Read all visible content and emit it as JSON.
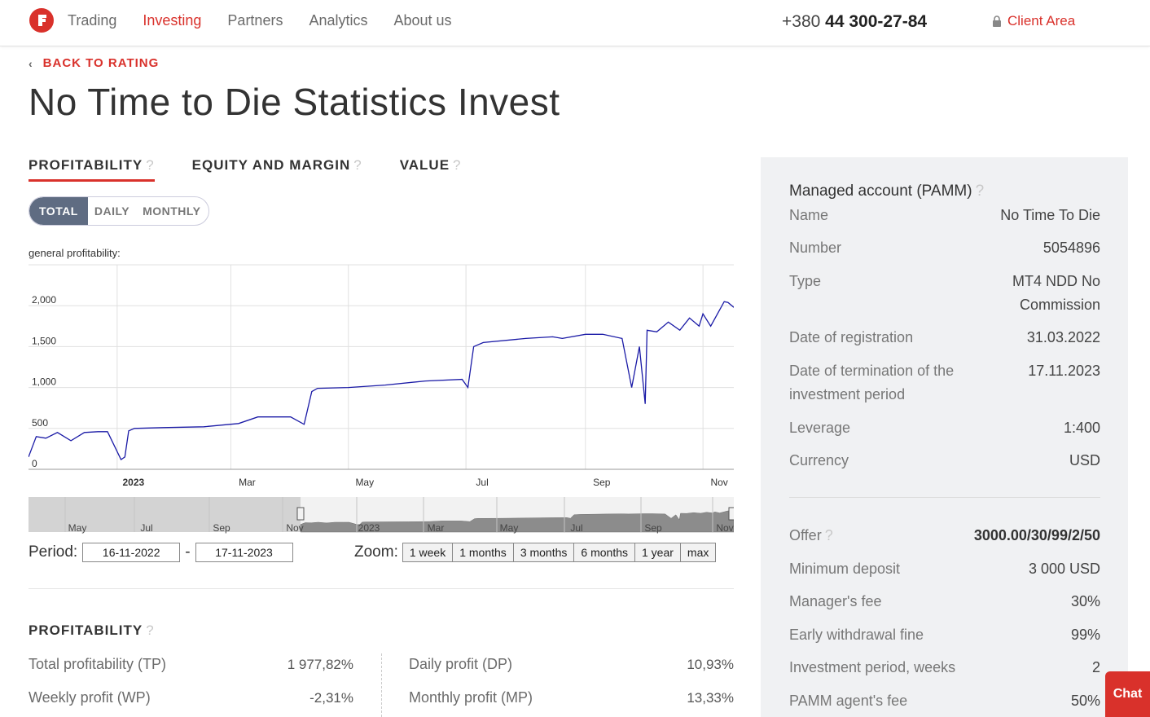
{
  "header": {
    "nav": [
      "Trading",
      "Investing",
      "Partners",
      "Analytics",
      "About us"
    ],
    "active_nav": "Investing",
    "phone_prefix": "+380 ",
    "phone_main": "44 300-27-84",
    "client_area": "Client Area"
  },
  "back_label": "BACK TO RATING",
  "page_title": "No Time to Die Statistics Invest",
  "tabs": [
    "PROFITABILITY",
    "EQUITY AND MARGIN",
    "VALUE"
  ],
  "tab_help": "?",
  "segments": [
    "TOTAL",
    "DAILY",
    "MONTHLY"
  ],
  "chart_caption": "general profitability:",
  "chart_data": {
    "type": "line",
    "title": "general profitability:",
    "x_ticks": [
      "2023",
      "Mar",
      "May",
      "Jul",
      "Sep",
      "Nov"
    ],
    "y_ticks": [
      "0",
      "500",
      "1,000",
      "1,500",
      "2,000"
    ],
    "ylim": [
      0,
      2500
    ],
    "xlim": [
      "2022-11-16",
      "2023-11-17"
    ],
    "x": [
      "2022-11-16",
      "2022-11-20",
      "2022-11-25",
      "2022-12-01",
      "2022-12-08",
      "2022-12-15",
      "2022-12-22",
      "2022-12-27",
      "2023-01-03",
      "2023-01-05",
      "2023-01-07",
      "2023-01-10",
      "2023-01-25",
      "2023-02-15",
      "2023-03-05",
      "2023-03-15",
      "2023-04-01",
      "2023-04-08",
      "2023-04-12",
      "2023-04-15",
      "2023-05-01",
      "2023-05-20",
      "2023-06-10",
      "2023-06-29",
      "2023-07-02",
      "2023-07-05",
      "2023-07-10",
      "2023-08-01",
      "2023-08-15",
      "2023-08-20",
      "2023-09-01",
      "2023-09-10",
      "2023-09-20",
      "2023-09-25",
      "2023-09-29",
      "2023-10-02",
      "2023-10-03",
      "2023-10-08",
      "2023-10-14",
      "2023-10-20",
      "2023-10-25",
      "2023-10-30",
      "2023-11-01",
      "2023-11-05",
      "2023-11-12",
      "2023-11-14",
      "2023-11-17"
    ],
    "values": [
      150,
      400,
      380,
      450,
      350,
      450,
      460,
      460,
      120,
      150,
      470,
      500,
      510,
      520,
      560,
      640,
      640,
      550,
      950,
      990,
      1000,
      1030,
      1080,
      1100,
      1000,
      1500,
      1550,
      1600,
      1620,
      1600,
      1650,
      1650,
      1600,
      1000,
      1500,
      800,
      1700,
      1680,
      1800,
      1700,
      1850,
      1750,
      1900,
      1750,
      2050,
      2040,
      1980
    ],
    "grid": true,
    "line_color": "#1a1aa6",
    "navigator_ticks": [
      "May",
      "Jul",
      "Sep",
      "Nov",
      "2023",
      "Mar",
      "May",
      "Jul",
      "Sep",
      "Nov"
    ]
  },
  "period": {
    "label": "Period:",
    "from": "16-11-2022",
    "sep": "-",
    "to": "17-11-2023"
  },
  "zoom": {
    "label": "Zoom:",
    "buttons": [
      "1 week",
      "1 months",
      "3 months",
      "6 months",
      "1 year",
      "max"
    ]
  },
  "profitability": {
    "title": "PROFITABILITY",
    "left": [
      {
        "label": "Total profitability (TP)",
        "value": "1 977,82%"
      },
      {
        "label": "Weekly profit (WP)",
        "value": "-2,31%"
      }
    ],
    "right": [
      {
        "label": "Daily profit (DP)",
        "value": "10,93%"
      },
      {
        "label": "Monthly profit (MP)",
        "value": "13,33%"
      }
    ]
  },
  "account": {
    "title": "Managed account (PAMM)",
    "rows": [
      {
        "label": "Name",
        "value": "No Time To Die"
      },
      {
        "label": "Number",
        "value": "5054896"
      },
      {
        "label": "Type",
        "value": "MT4 NDD No Commission"
      },
      {
        "label": "Date of registration",
        "value": "31.03.2022"
      },
      {
        "label": "Date of termination of the investment period",
        "value": "17.11.2023"
      },
      {
        "label": "Leverage",
        "value": "1:400"
      },
      {
        "label": "Currency",
        "value": "USD"
      }
    ],
    "offer_label": "Offer",
    "offer_value": "3000.00/30/99/2/50",
    "terms": [
      {
        "label": "Minimum deposit",
        "value": "3 000 USD"
      },
      {
        "label": "Manager's fee",
        "value": "30%"
      },
      {
        "label": "Early withdrawal fine",
        "value": "99%"
      },
      {
        "label": "Investment period, weeks",
        "value": "2"
      },
      {
        "label": "PAMM agent's fee",
        "value": "50%"
      }
    ]
  },
  "chat_label": "Chat",
  "colors": {
    "accent": "#d9312b",
    "segment_active": "#5f6c82",
    "panel_bg": "#f0f1f3"
  }
}
